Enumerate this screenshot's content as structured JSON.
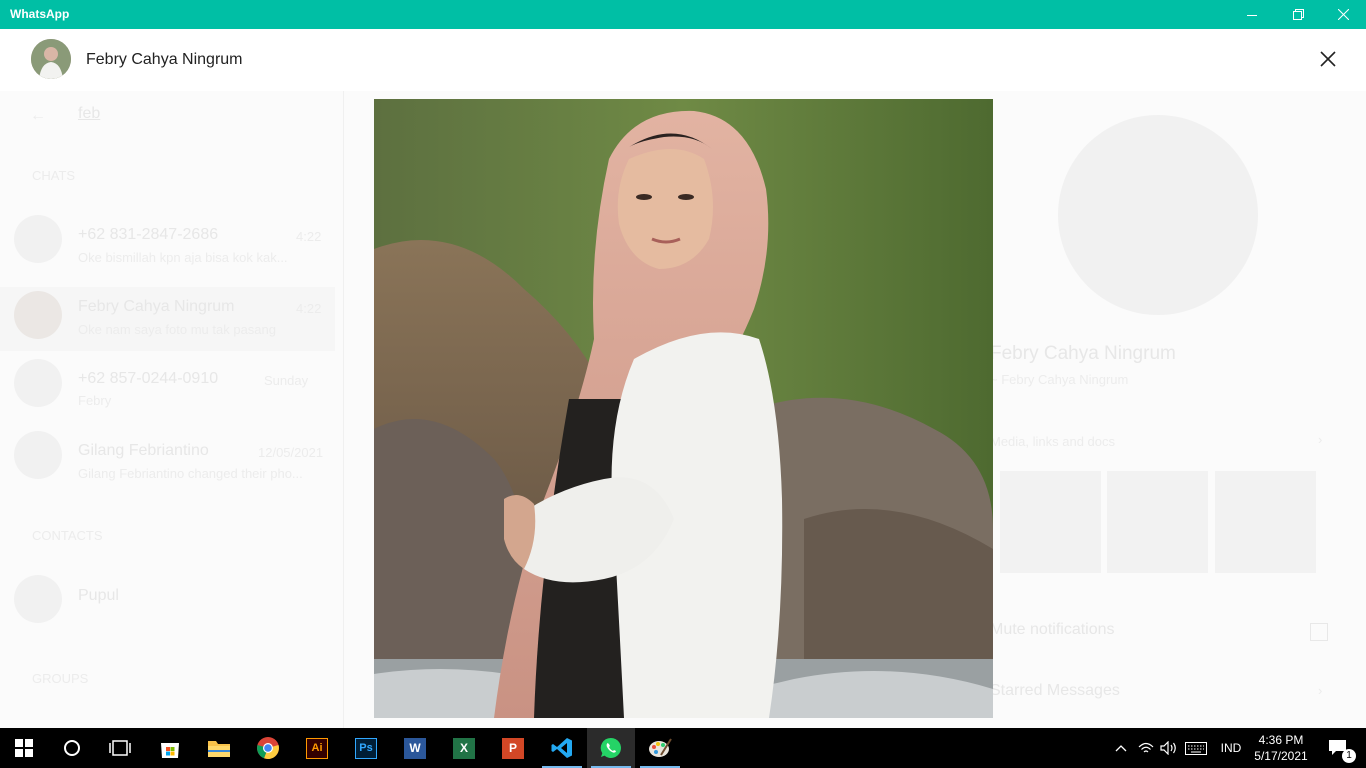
{
  "window": {
    "title": "WhatsApp",
    "minimize_icon": "minimize-icon",
    "maximize_icon": "restore-icon",
    "close_icon": "close-icon"
  },
  "viewer": {
    "contact_name": "Febry Cahya Ningrum",
    "avatar_icon": "contact-avatar",
    "close_icon": "close-icon"
  },
  "background": {
    "search_value": "feb",
    "sections": {
      "chats": "CHATS",
      "contacts": "CONTACTS",
      "groups": "GROUPS"
    },
    "chats": [
      {
        "name": "+62 831-2847-2686",
        "time": "4:22",
        "preview": "Oke bismillah kpn aja bisa kok kak..."
      },
      {
        "name": "Febry Cahya Ningrum",
        "time": "4:22",
        "preview": "Oke nam saya foto mu tak pasang"
      },
      {
        "name": "+62 857-0244-0910",
        "time": "Sunday",
        "preview": "Febry"
      },
      {
        "name": "Gilang Febriantino",
        "time": "12/05/2021",
        "preview": "Gilang Febriantino changed their pho..."
      }
    ],
    "contacts": [
      {
        "name": "Pupul"
      }
    ],
    "profile": {
      "name": "Febry Cahya Ningrum",
      "subtitle": "~ Febry Cahya Ningrum",
      "media_label": "Media, links and docs",
      "mute_label": "Mute notifications",
      "starred_label": "Starred Messages"
    }
  },
  "photo": {
    "subject": "profile-photo-woman-pink-hijab-white-jacket-rocky-beach"
  },
  "taskbar": {
    "apps": [
      {
        "name": "start",
        "icon": "windows-start-icon"
      },
      {
        "name": "search",
        "icon": "cortana-circle-icon"
      },
      {
        "name": "task-view",
        "icon": "task-view-icon"
      },
      {
        "name": "store",
        "icon": "microsoft-store-icon"
      },
      {
        "name": "file-explorer",
        "icon": "folder-icon"
      },
      {
        "name": "chrome",
        "icon": "chrome-icon"
      },
      {
        "name": "illustrator",
        "icon": "illustrator-icon",
        "label": "Ai"
      },
      {
        "name": "photoshop",
        "icon": "photoshop-icon",
        "label": "Ps"
      },
      {
        "name": "word",
        "icon": "word-icon",
        "label": "W"
      },
      {
        "name": "excel",
        "icon": "excel-icon",
        "label": "X"
      },
      {
        "name": "powerpoint",
        "icon": "powerpoint-icon",
        "label": "P"
      },
      {
        "name": "vscode",
        "icon": "vscode-icon"
      },
      {
        "name": "whatsapp",
        "icon": "whatsapp-icon"
      },
      {
        "name": "paint",
        "icon": "paint-icon"
      }
    ],
    "tray": {
      "language": "IND",
      "time": "4:36 PM",
      "date": "5/17/2021",
      "notification_count": "1"
    }
  }
}
